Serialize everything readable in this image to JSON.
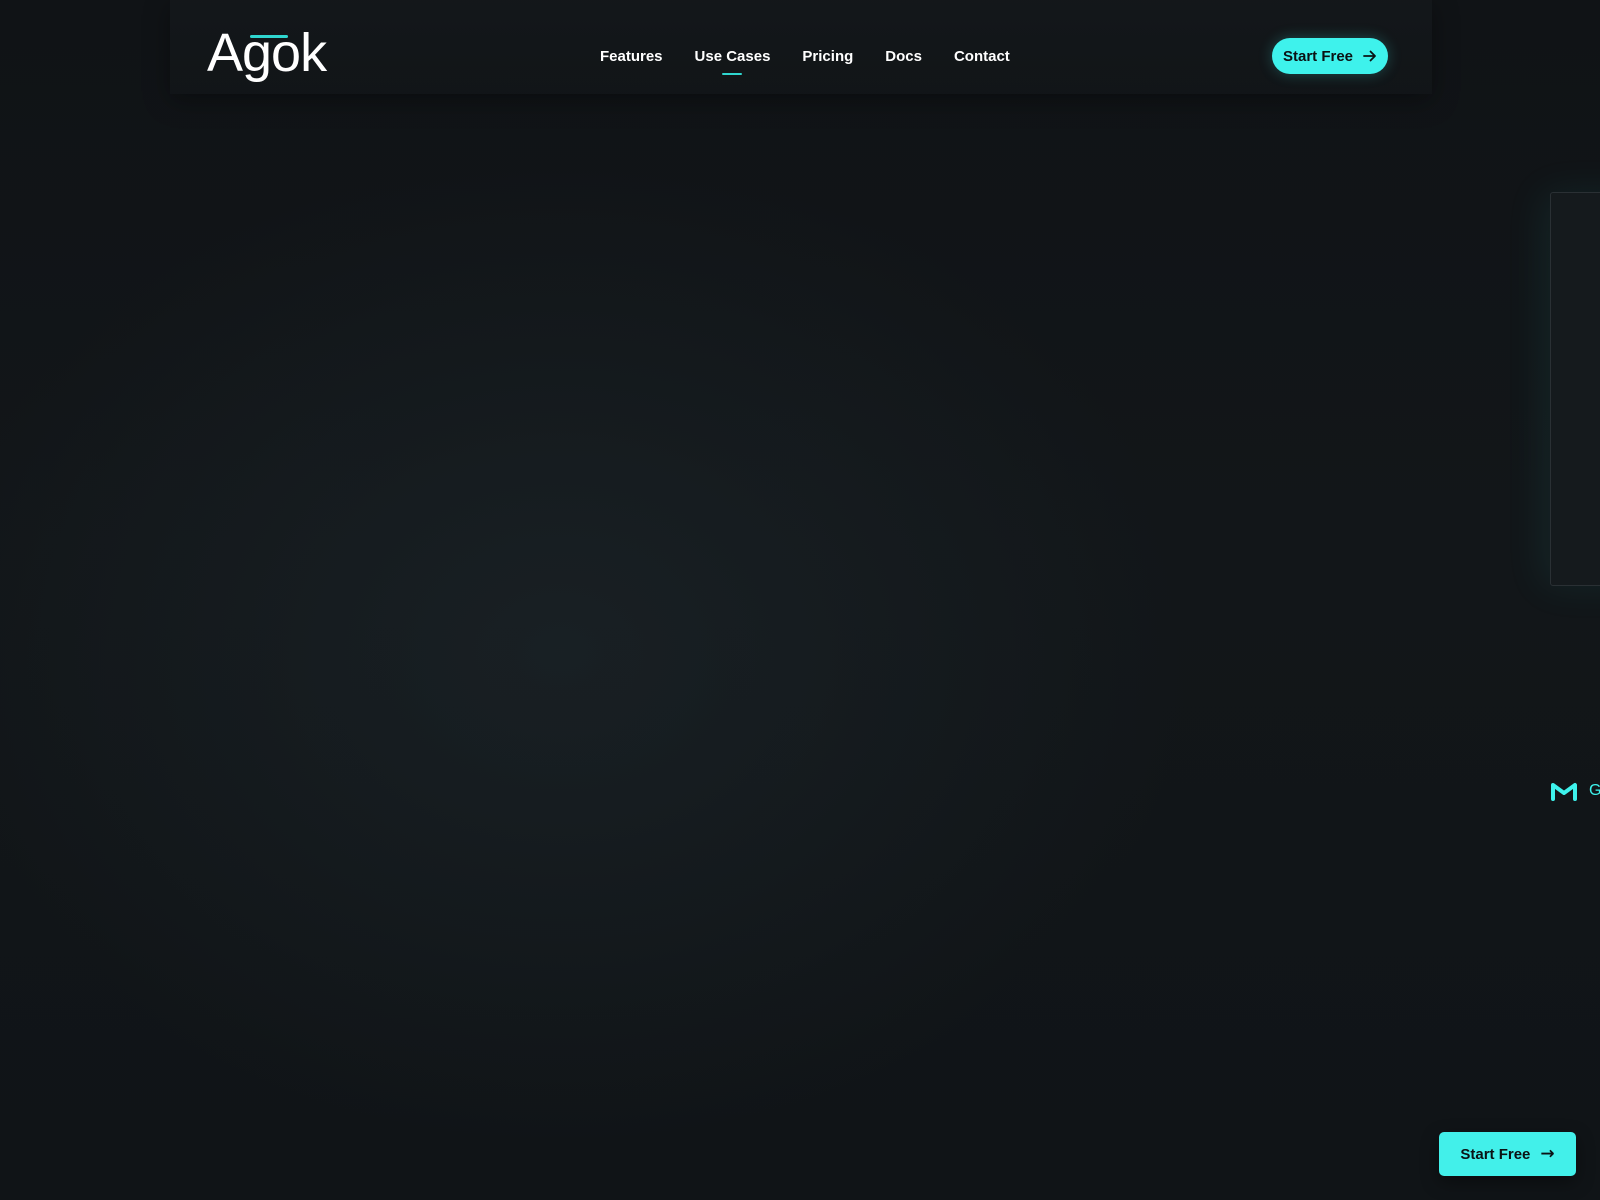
{
  "brand": {
    "logo_text": "Agok",
    "accent_color": "#3ef2ec"
  },
  "nav": {
    "items": [
      {
        "label": "Features",
        "active": false
      },
      {
        "label": "Use Cases",
        "active": true
      },
      {
        "label": "Pricing",
        "active": false
      },
      {
        "label": "Docs",
        "active": false
      },
      {
        "label": "Contact",
        "active": false
      }
    ]
  },
  "header": {
    "cta_label": "Start Free",
    "cta_icon": "arrow-right-icon"
  },
  "side": {
    "integration_icon": "gmail-icon",
    "integration_label": "G"
  },
  "floating_cta": {
    "label": "Start Free",
    "arrow": "→"
  }
}
